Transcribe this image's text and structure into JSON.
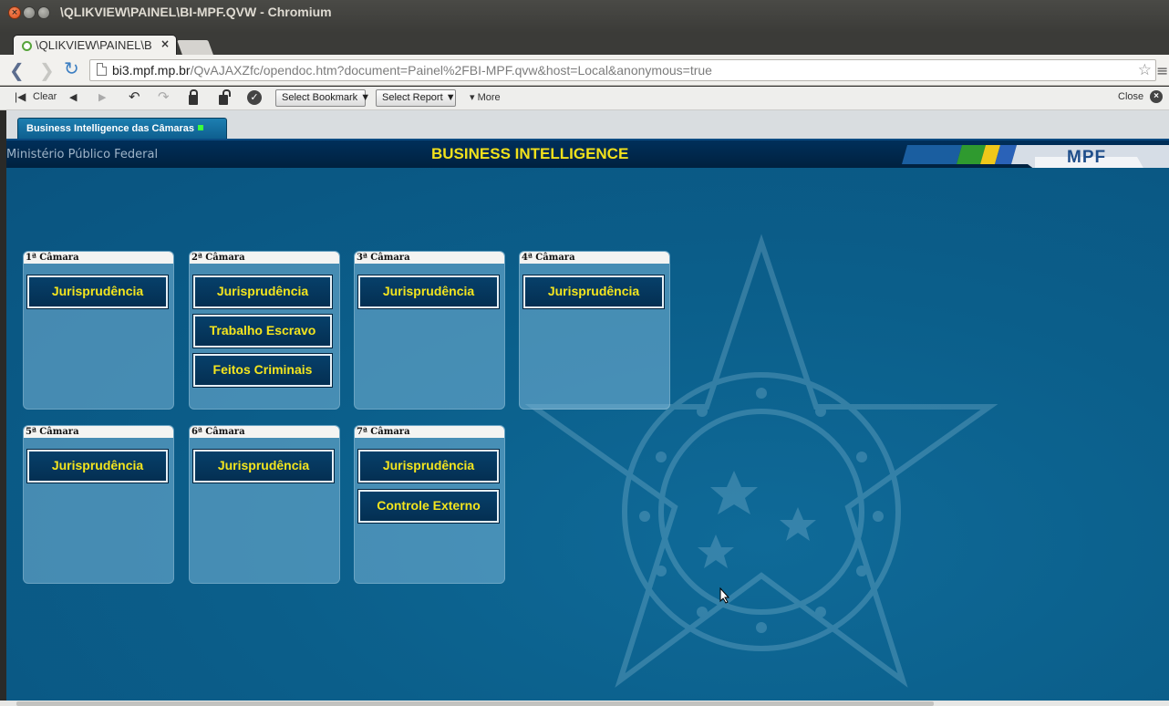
{
  "window": {
    "title": "\\QLIKVIEW\\PAINEL\\BI-MPF.QVW - Chromium"
  },
  "browser": {
    "tab": {
      "title": "\\QLIKVIEW\\PAINEL\\BI",
      "close": "×"
    },
    "url": {
      "host": "bi3.mpf.mp.br",
      "path": "/QvAJAXZfc/opendoc.htm?document=Painel%2FBI-MPF.qvw&host=Local&anonymous=true"
    }
  },
  "qv_toolbar": {
    "clear_label": "Clear",
    "bookmark_label": "Select Bookmark ▼",
    "report_label": "Select Report ▼",
    "more_label": "▾ More",
    "close_label": "Close"
  },
  "sheet_tab": {
    "label": "Business Intelligence das Câmaras"
  },
  "header": {
    "organization": "Ministério Público Federal",
    "title": "BUSINESS INTELLIGENCE",
    "logo": "MPF"
  },
  "panels": [
    {
      "caption": "1ª Câmara",
      "buttons": [
        "Jurisprudência"
      ]
    },
    {
      "caption": "2ª Câmara",
      "buttons": [
        "Jurisprudência",
        "Trabalho Escravo",
        "Feitos Criminais"
      ]
    },
    {
      "caption": "3ª Câmara",
      "buttons": [
        "Jurisprudência"
      ]
    },
    {
      "caption": "4ª Câmara",
      "buttons": [
        "Jurisprudência"
      ]
    },
    {
      "caption": "5ª Câmara",
      "buttons": [
        "Jurisprudência"
      ]
    },
    {
      "caption": "6ª Câmara",
      "buttons": [
        "Jurisprudência"
      ]
    },
    {
      "caption": "7ª Câmara",
      "buttons": [
        "Jurisprudência",
        "Controle Externo"
      ]
    }
  ],
  "colors": {
    "header_bg": "#002f5a",
    "accent_yellow": "#f3e11b",
    "canvas_bg": "#0b5f8b",
    "button_bg": "#07406a"
  }
}
